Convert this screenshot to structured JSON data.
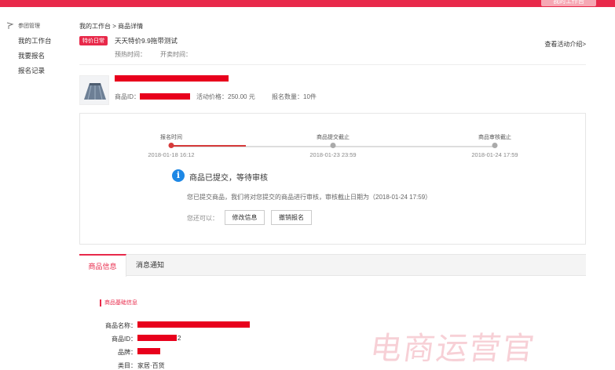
{
  "header": {
    "workbench_button": "我的工作台"
  },
  "sidebar": {
    "section": "参团管理",
    "items": [
      {
        "label": "我的工作台"
      },
      {
        "label": "我要报名"
      },
      {
        "label": "报名记录"
      }
    ]
  },
  "breadcrumb": "我的工作台 > 商品详情",
  "activity": {
    "tag": "特价日常",
    "title": "天天特价9.9拖带测试",
    "preheat_label": "预热时间：",
    "open_label": "开卖时间：",
    "view_intro": "查看活动介绍>"
  },
  "product": {
    "id_label": "商品ID：",
    "price_text": "活动价格：250.00 元",
    "quantity_text": "报名数量：10件"
  },
  "progress": {
    "filled_fraction": 0.23,
    "steps": [
      {
        "label": "报名时间",
        "date": "2018-01-18 16:12"
      },
      {
        "label": "商品提交截止",
        "date": "2018-01-23 23:59"
      },
      {
        "label": "商品审核截止",
        "date": "2018-01-24 17:59"
      }
    ]
  },
  "status": {
    "icon": "info-icon",
    "title": "商品已提交，等待审核",
    "description": "您已提交商品，我们将对您提交的商品进行审核，审核截止日期为（2018-01-24 17:59）",
    "can_label": "您还可以：",
    "edit_button": "修改信息",
    "cancel_button": "撤销报名"
  },
  "tabs": [
    {
      "label": "商品信息"
    },
    {
      "label": "消息通知"
    }
  ],
  "details": {
    "section_title": "商品基础信息",
    "fields": [
      {
        "label": "商品名称：",
        "value": ""
      },
      {
        "label": "商品ID：",
        "value": "2"
      },
      {
        "label": "品牌：",
        "value": ""
      },
      {
        "label": "类目：",
        "value": "家居·百货"
      }
    ]
  },
  "watermark": "电商运营官",
  "colors": {
    "accent": "#e8294a",
    "redact": "#e8001c",
    "info": "#1e88e5"
  }
}
